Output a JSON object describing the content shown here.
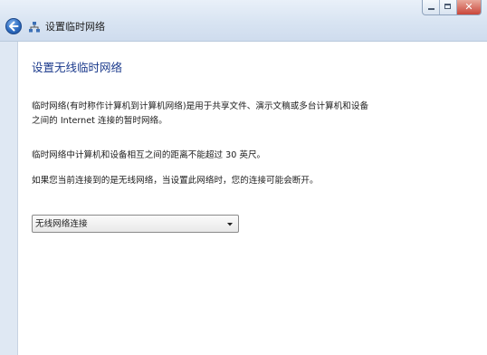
{
  "window": {
    "title": "设置临时网络",
    "back_icon": "back-arrow-icon",
    "network_icon": "network-icon",
    "controls": [
      "minimize-icon",
      "maximize-icon",
      "close-icon"
    ]
  },
  "main": {
    "heading": "设置无线临时网络",
    "paragraph1_line1": "临时网络(有时称作计算机到计算机网络)是用于共享文件、演示文稿或多台计算机和设备",
    "paragraph1_line2": "之间的 Internet 连接的暂时网络。",
    "paragraph2": "临时网络中计算机和设备相互之间的距离不能超过 30 英尺。",
    "paragraph3": "如果您当前连接到的是无线网络，当设置此网络时，您的连接可能会断开。",
    "connection_select": {
      "selected": "无线网络连接"
    }
  },
  "colors": {
    "heading": "#1b3a8c",
    "chrome": "#dfe8f3",
    "back_button": "#2d6cc1"
  }
}
